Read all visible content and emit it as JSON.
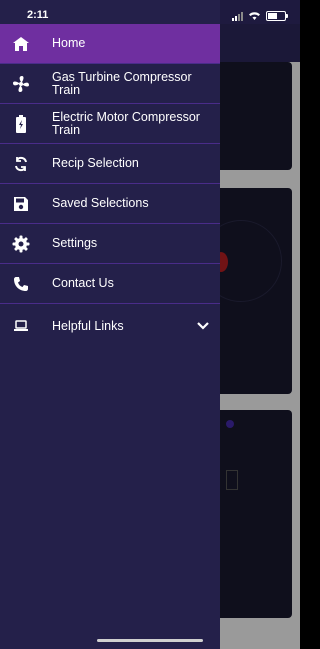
{
  "status_bar": {
    "time": "2:11"
  },
  "menu": {
    "items": [
      {
        "label": "Home",
        "icon": "home-icon",
        "active": true
      },
      {
        "label": "Gas Turbine Compressor Train",
        "icon": "fan-icon"
      },
      {
        "label": "Electric Motor Compressor Train",
        "icon": "battery-icon"
      },
      {
        "label": "Recip Selection",
        "icon": "sync-icon"
      },
      {
        "label": "Saved Selections",
        "icon": "save-icon"
      },
      {
        "label": "Settings",
        "icon": "gear-icon"
      },
      {
        "label": "Contact Us",
        "icon": "phone-icon"
      },
      {
        "label": "Helpful Links",
        "icon": "laptop-icon",
        "expandable": true
      }
    ]
  },
  "colors": {
    "drawer_bg": "#24204a",
    "active_bg": "#6f2fa0",
    "divider": "#4a2c8a"
  }
}
